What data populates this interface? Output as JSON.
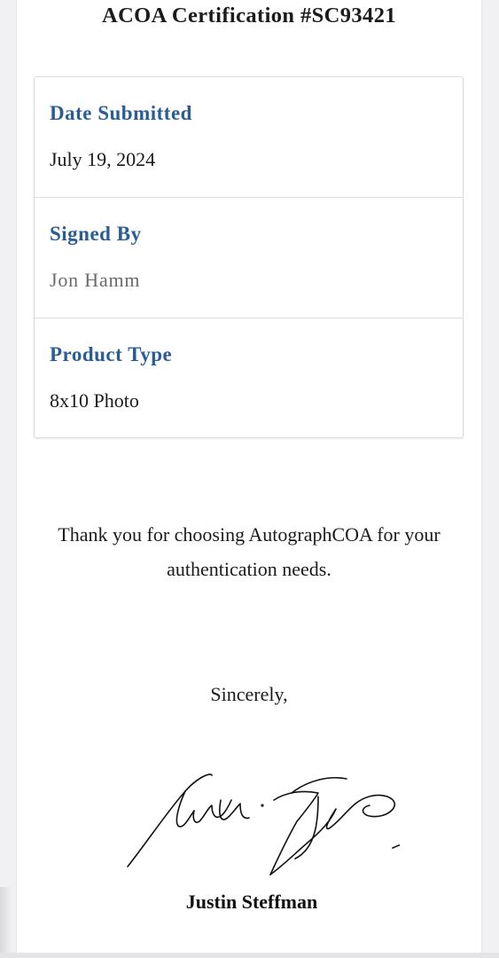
{
  "certificate": {
    "title": "ACOA Certification #SC93421"
  },
  "details": [
    {
      "label": "Date Submitted",
      "value": "July 19, 2024"
    },
    {
      "label": "Signed By",
      "value": "Jon Hamm"
    },
    {
      "label": "Product Type",
      "value": "8x10 Photo"
    }
  ],
  "message": {
    "thanks": "Thank you for choosing AutographCOA for your authentication needs.",
    "closing": "Sincerely,"
  },
  "signer": {
    "name": "Justin Steffman",
    "signature_text": "Justin Steffman"
  },
  "colors": {
    "label_blue": "#2a5d95",
    "text": "#1b1b1b",
    "muted": "#6b6b6b"
  }
}
